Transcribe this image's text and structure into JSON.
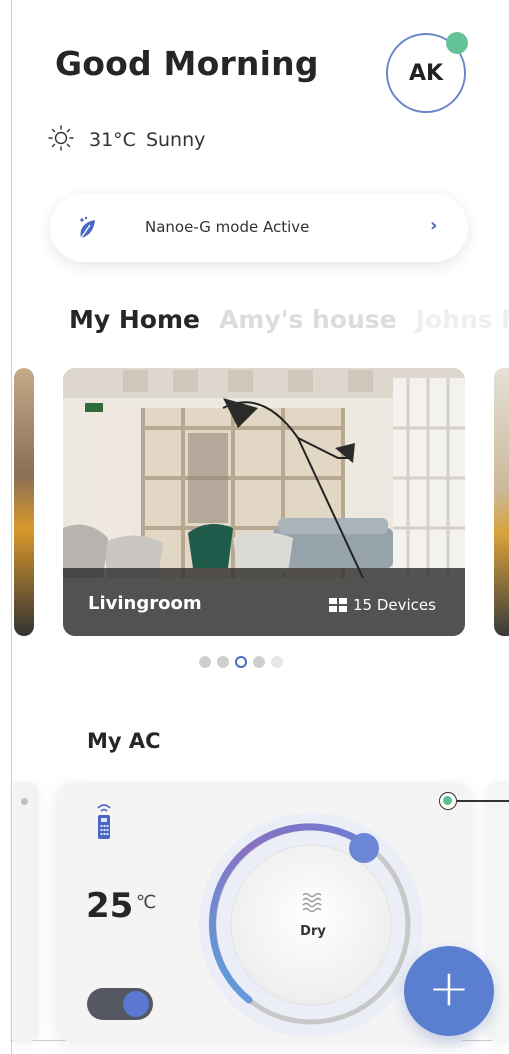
{
  "header": {
    "greeting": "Good Morning",
    "avatar_initials": "AK",
    "online_status_color": "#64c396"
  },
  "weather": {
    "icon": "sun-icon",
    "temperature": "31°C",
    "condition": "Sunny"
  },
  "mode_banner": {
    "icon": "leaf-icon",
    "text": "Nanoe-G mode Active",
    "chevron": "›"
  },
  "homes": {
    "tabs": [
      {
        "label": "My Home",
        "active": true
      },
      {
        "label": "Amy's house",
        "active": false
      },
      {
        "label": "Johns h",
        "active": false
      }
    ]
  },
  "room_carousel": {
    "current": {
      "name": "Livingroom",
      "devices_label": "15 Devices",
      "devices_icon": "grid-icon"
    },
    "page_count": 5,
    "active_index": 2
  },
  "ac_section": {
    "title": "My AC",
    "card": {
      "remote_icon": "remote-icon",
      "temperature": "25",
      "unit": "℃",
      "power_on": true,
      "mode_label": "Dry",
      "mode_icon": "dry-wave-icon",
      "dial_level": 0.62
    }
  },
  "fab": {
    "label": "+",
    "color": "#5a7fd0"
  },
  "colors": {
    "accent": "#5a7fd0",
    "status_green": "#5bbf8a",
    "dial_purple": "#8a6fc2",
    "dial_blue": "#5aa3e0"
  }
}
